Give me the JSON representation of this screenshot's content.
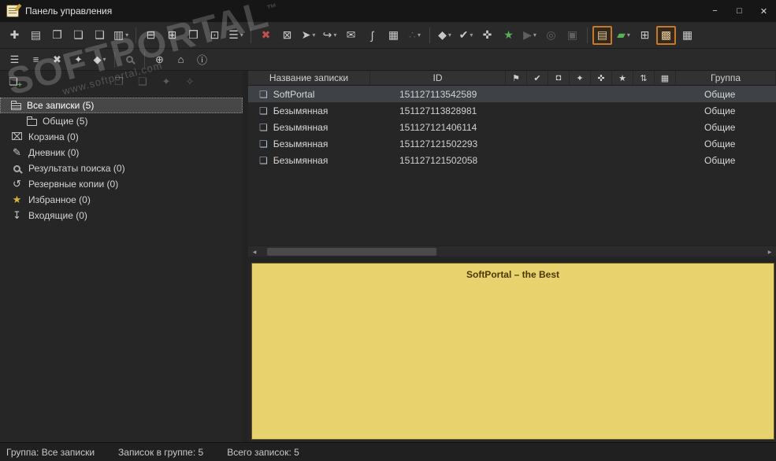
{
  "colors": {
    "titlebar_bg": "#161616",
    "toolbar_bg": "#2a2a2a",
    "window_bg": "#2e2e2e",
    "panel_bg": "#262626",
    "border_dark": "#1c1c1c",
    "text": "#d6d6d6",
    "header_bg": "#323232",
    "row_selected": "#3e4246",
    "tree_selected": "#474747",
    "accent_orange": "#c9772b",
    "icon_green": "#58b058",
    "icon_red": "#c05050",
    "note_bg": "#e8d26e",
    "note_text": "#4a3800",
    "statusbar_bg": "#202020",
    "scroll_thumb": "#4a4a4a",
    "disabled": "#5f5f5f"
  },
  "window": {
    "title": "Панель управления",
    "controls": {
      "minimize": "−",
      "maximize": "□",
      "close": "✕"
    }
  },
  "watermark": {
    "brand": "SOFTPORTAL",
    "tm": "™",
    "url": "www.softportal.com"
  },
  "toolbar_row1": {
    "items": [
      {
        "name": "new-note-button",
        "glyph": "✚"
      },
      {
        "name": "import-note-button",
        "glyph": "▤"
      },
      {
        "name": "copy-note-button",
        "glyph": "❐"
      },
      {
        "name": "paste-note-button",
        "glyph": "❏"
      },
      {
        "name": "duplicate-note-button",
        "glyph": "❑"
      },
      {
        "name": "templates-menu-button",
        "glyph": "▥"
      },
      {
        "name": "save-note-button",
        "glyph": "⊟"
      },
      {
        "name": "export-note-button",
        "glyph": "⊞"
      },
      {
        "name": "print-preview-button",
        "glyph": "❒"
      },
      {
        "name": "print-note-button",
        "glyph": "⊡"
      },
      {
        "name": "sort-menu-button",
        "glyph": "☰"
      },
      {
        "name": "delete-note-button",
        "glyph": "✖"
      },
      {
        "name": "archive-note-button",
        "glyph": "⊠"
      },
      {
        "name": "send-menu-button",
        "glyph": "➤"
      },
      {
        "name": "insert-menu-button",
        "glyph": "↪"
      },
      {
        "name": "email-note-button",
        "glyph": "✉"
      },
      {
        "name": "attach-file-button",
        "glyph": "∫"
      },
      {
        "name": "insert-table-button",
        "glyph": "▦"
      },
      {
        "name": "relations-menu-button",
        "glyph": "∴"
      },
      {
        "name": "tags-menu-button",
        "glyph": "◆"
      },
      {
        "name": "todo-menu-button",
        "glyph": "✔"
      },
      {
        "name": "pin-note-button",
        "glyph": "✜"
      },
      {
        "name": "add-favorite-button",
        "glyph": "★"
      },
      {
        "name": "run-menu-button",
        "glyph": "▶"
      },
      {
        "name": "link-note-button",
        "glyph": "◎"
      },
      {
        "name": "protect-note-button",
        "glyph": "▣"
      },
      {
        "name": "panel-view-button",
        "glyph": "▤"
      },
      {
        "name": "color-menu-button",
        "glyph": "▰"
      },
      {
        "name": "table-mode-button",
        "glyph": "⊞"
      },
      {
        "name": "grid-mode-button",
        "glyph": "▩"
      },
      {
        "name": "calendar-mode-button",
        "glyph": "▦"
      }
    ]
  },
  "toolbar_row2": {
    "items": [
      {
        "name": "structure-menu-button",
        "glyph": "☰"
      },
      {
        "name": "order-menu-button",
        "glyph": "≡"
      },
      {
        "name": "clear-button",
        "glyph": "✖"
      },
      {
        "name": "password-button",
        "glyph": "✦"
      },
      {
        "name": "encrypt-menu-button",
        "glyph": "◆"
      },
      {
        "name": "search-button",
        "glyph": ""
      },
      {
        "name": "web-services-button",
        "glyph": "⊕"
      },
      {
        "name": "home-page-button",
        "glyph": "⌂"
      },
      {
        "name": "info-button",
        "glyph": "ⓘ"
      }
    ]
  },
  "group_toolbar": {
    "items": [
      {
        "name": "add-group-button",
        "glyph": "❏"
      },
      {
        "name": "new-subgroup-button",
        "glyph": "❐"
      },
      {
        "name": "group-folders-button",
        "glyph": "❑"
      },
      {
        "name": "set-group-password-button",
        "glyph": "✦"
      },
      {
        "name": "remove-group-password-button",
        "glyph": "✧"
      }
    ]
  },
  "tree": {
    "items": [
      {
        "label": "Все записки (5)"
      },
      {
        "label": "Общие (5)"
      },
      {
        "label": "Корзина (0)",
        "icon": "⌧"
      },
      {
        "label": "Дневник (0)",
        "icon": "✎"
      },
      {
        "label": "Результаты поиска (0)",
        "icon": ""
      },
      {
        "label": "Резервные копии (0)",
        "icon": "↺"
      },
      {
        "label": "Избранное (0)",
        "icon": "★"
      },
      {
        "label": "Входящие (0)",
        "icon": "↧"
      }
    ]
  },
  "list": {
    "headers": {
      "name": "Название записки",
      "id": "ID",
      "group": "Группа"
    },
    "icon_headers": [
      {
        "name": "flag-icon",
        "glyph": "⚑"
      },
      {
        "name": "check-icon",
        "glyph": "✔"
      },
      {
        "name": "lock-icon",
        "glyph": "◘"
      },
      {
        "name": "key-icon",
        "glyph": "✦"
      },
      {
        "name": "pin-icon",
        "glyph": "✜"
      },
      {
        "name": "star-icon",
        "glyph": "★"
      },
      {
        "name": "sort-icon",
        "glyph": "⇅"
      },
      {
        "name": "date-icon",
        "glyph": "▦"
      }
    ],
    "rows": [
      {
        "name": "SoftPortal",
        "id": "151127113542589",
        "group": "Общие"
      },
      {
        "name": "Безымянная",
        "id": "151127113828981",
        "group": "Общие"
      },
      {
        "name": "Безымянная",
        "id": "151127121406114",
        "group": "Общие"
      },
      {
        "name": "Безымянная",
        "id": "151127121502293",
        "group": "Общие"
      },
      {
        "name": "Безымянная",
        "id": "151127121502058",
        "group": "Общие"
      }
    ]
  },
  "icons": {
    "note": "❏",
    "scroll_left": "◂",
    "scroll_right": "▸"
  },
  "note_preview": {
    "title": "SoftPortal – the Best"
  },
  "statusbar": {
    "group": "Группа: Все записки",
    "in_group": "Записок в группе: 5",
    "total": "Всего записок: 5"
  }
}
